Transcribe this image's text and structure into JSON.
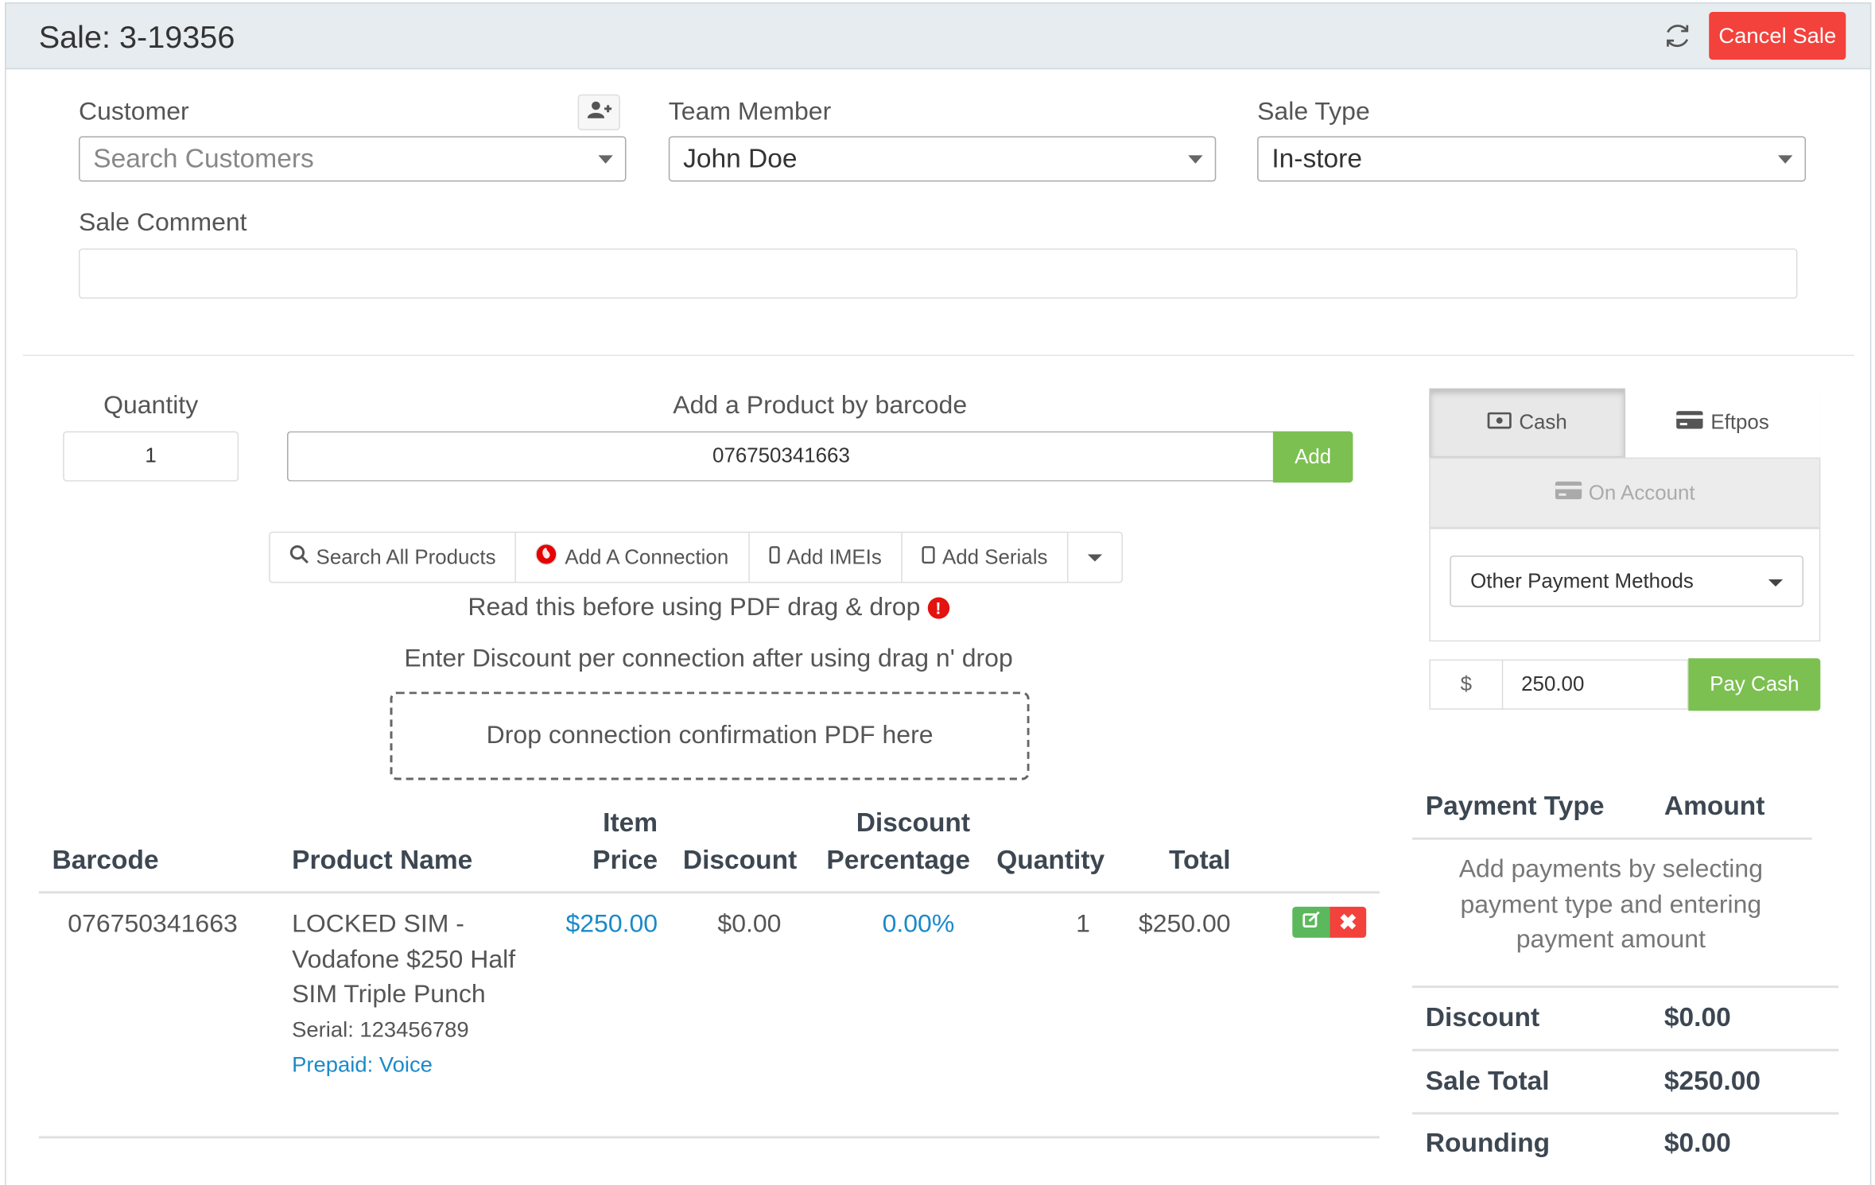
{
  "header": {
    "title": "Sale: 3-19356",
    "cancel_label": "Cancel Sale"
  },
  "form": {
    "customer_label": "Customer",
    "customer_placeholder": "Search Customers",
    "team_member_label": "Team Member",
    "team_member_value": "John Doe",
    "sale_type_label": "Sale Type",
    "sale_type_value": "In-store",
    "sale_comment_label": "Sale Comment",
    "sale_comment_value": ""
  },
  "product_entry": {
    "quantity_label": "Quantity",
    "quantity_value": "1",
    "barcode_label": "Add a Product by barcode",
    "barcode_value": "076750341663",
    "add_label": "Add"
  },
  "actions": {
    "search_all": "Search All Products",
    "add_connection": "Add A Connection",
    "add_imeis": "Add IMEIs",
    "add_serials": "Add Serials"
  },
  "notices": {
    "pdf_notice": "Read this before using PDF drag & drop",
    "discount_notice": "Enter Discount per connection after using drag n' drop",
    "dropzone": "Drop connection confirmation PDF here"
  },
  "table": {
    "headers": {
      "barcode": "Barcode",
      "product_name": "Product Name",
      "item_price_1": "Item",
      "item_price_2": "Price",
      "discount": "Discount",
      "disc_pct_1": "Discount",
      "disc_pct_2": "Percentage",
      "quantity": "Quantity",
      "total": "Total"
    },
    "rows": [
      {
        "barcode": "076750341663",
        "name_line1": "LOCKED SIM -",
        "name_line2": "Vodafone $250 Half",
        "name_line3": "SIM Triple Punch",
        "serial": "Serial: 123456789",
        "plan": "Prepaid: Voice",
        "item_price": "$250.00",
        "discount": "$0.00",
        "discount_pct": "0.00%",
        "quantity": "1",
        "total": "$250.00"
      }
    ]
  },
  "payment": {
    "tab_cash": "Cash",
    "tab_eftpos": "Eftpos",
    "tab_account": "On Account",
    "other_methods": "Other Payment Methods",
    "currency": "$",
    "amount": "250.00",
    "pay_label": "Pay Cash"
  },
  "summary": {
    "col_type": "Payment Type",
    "col_amount": "Amount",
    "hint": "Add payments by selecting payment type and entering payment amount",
    "discount_label": "Discount",
    "discount_value": "$0.00",
    "sale_total_label": "Sale Total",
    "sale_total_value": "$250.00",
    "rounding_label": "Rounding",
    "rounding_value": "$0.00"
  },
  "colors": {
    "accent_green": "#7cc051",
    "danger_red": "#f3413c",
    "link_blue": "#1a8ac9"
  }
}
